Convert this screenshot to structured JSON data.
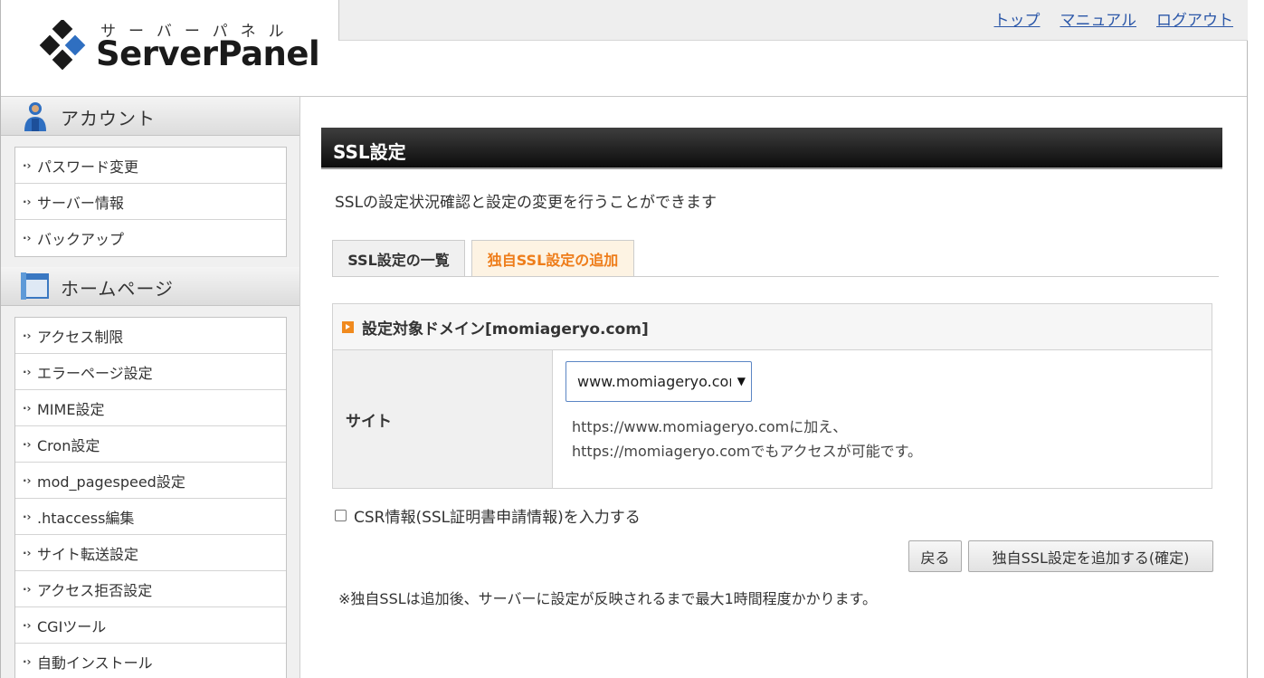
{
  "logo": {
    "kana": "サーバーパネル",
    "name": "ServerPanel"
  },
  "topnav": {
    "items": [
      "トップ",
      "マニュアル",
      "ログアウト"
    ]
  },
  "sidebar": {
    "account": {
      "title": "アカウント",
      "items": [
        "パスワード変更",
        "サーバー情報",
        "バックアップ"
      ]
    },
    "homepage": {
      "title": "ホームページ",
      "items": [
        "アクセス制限",
        "エラーページ設定",
        "MIME設定",
        "Cron設定",
        "mod_pagespeed設定",
        ".htaccess編集",
        "サイト転送設定",
        "アクセス拒否設定",
        "CGIツール",
        "自動インストール"
      ]
    }
  },
  "main": {
    "title": "SSL設定",
    "description": "SSLの設定状況確認と設定の変更を行うことができます",
    "tabs": [
      "SSL設定の一覧",
      "独自SSL設定の追加"
    ],
    "active_tab": "独自SSL設定の追加",
    "panel": {
      "heading": "設定対象ドメイン[momiageryo.com]",
      "site_label": "サイト",
      "site_value": "www.momiageryo.com",
      "note_line1": "https://www.momiageryo.comに加え、",
      "note_line2": "https://momiageryo.comでもアクセスが可能です。"
    },
    "csr_label": "CSR情報(SSL証明書申請情報)を入力する",
    "csr_checked": false,
    "back_button": "戻る",
    "confirm_button": "独自SSL設定を追加する(確定)",
    "footnote": "※独自SSLは追加後、サーバーに設定が反映されるまで最大1時間程度かかります。"
  },
  "colors": {
    "link": "#2b57a8",
    "active_tab": "#ee7d1a",
    "logo_blue": "#2f6fc1"
  }
}
